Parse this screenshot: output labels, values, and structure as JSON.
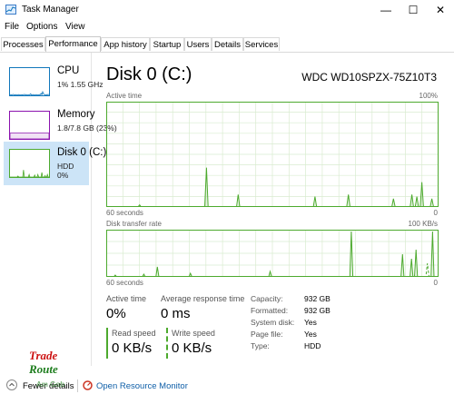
{
  "window": {
    "title": "Task Manager",
    "minimize": "—",
    "maximize": "☐",
    "close": "✕"
  },
  "menu": [
    "File",
    "Options",
    "View"
  ],
  "tabs": [
    "Processes",
    "Performance",
    "App history",
    "Startup",
    "Users",
    "Details",
    "Services"
  ],
  "active_tab": "Performance",
  "sidebar": [
    {
      "name": "CPU",
      "sub1": "1% 1.55 GHz",
      "sub2": ""
    },
    {
      "name": "Memory",
      "sub1": "1.8/7.8 GB (23%)",
      "sub2": ""
    },
    {
      "name": "Disk 0 (C:)",
      "sub1": "HDD",
      "sub2": "0%"
    }
  ],
  "disk": {
    "title": "Disk 0 (C:)",
    "model": "WDC WD10SPZX-75Z10T3",
    "active_time_label": "Active time",
    "active_time_max": "100%",
    "time_left": "60 seconds",
    "time_right": "0",
    "transfer_label": "Disk transfer rate",
    "transfer_max": "100 KB/s",
    "transfer_time_left": "60 seconds",
    "transfer_time_right": "0"
  },
  "stats": {
    "active_time_label": "Active time",
    "active_time_value": "0%",
    "avg_response_label": "Average response time",
    "avg_response_value": "0 ms",
    "read_label": "Read speed",
    "read_value": "0 KB/s",
    "write_label": "Write speed",
    "write_value": "0 KB/s"
  },
  "info": [
    {
      "label": "Capacity:",
      "value": "932 GB"
    },
    {
      "label": "Formatted:",
      "value": "932 GB"
    },
    {
      "label": "System disk:",
      "value": "Yes"
    },
    {
      "label": "Page file:",
      "value": "Yes"
    },
    {
      "label": "Type:",
      "value": "HDD"
    }
  ],
  "footer": {
    "fewer_details": "Fewer details",
    "open_monitor": "Open Resource Monitor",
    "watermark_line1": "Trade",
    "watermark_line2": "Route",
    "watermark_line3": "Am Gob"
  },
  "colors": {
    "disk_green": "#4daa2e",
    "grid_green": "#d9ecd0",
    "mem_purple": "#8b12ae",
    "cpu_blue": "#1177bb",
    "selected_bg": "#cce4f7",
    "link_blue": "#0f5fa8",
    "watermark_red": "#cc1111",
    "watermark_green": "#1d7d1d"
  },
  "charts": {
    "active_time": [
      0,
      0,
      0,
      0,
      0,
      0,
      0,
      0,
      0,
      0,
      0,
      0,
      0,
      0,
      0,
      0,
      0,
      0,
      0,
      0,
      2,
      0,
      0,
      0,
      0,
      0,
      0,
      0,
      0,
      0,
      0,
      0,
      0,
      0,
      0,
      0,
      0,
      0,
      0,
      0,
      0,
      0,
      0,
      0,
      0,
      0,
      0,
      0,
      0,
      0,
      0,
      0,
      0,
      0,
      0,
      0,
      0,
      0,
      0,
      0,
      38,
      0,
      0,
      0,
      0,
      0,
      0,
      0,
      0,
      0,
      0,
      0,
      0,
      0,
      0,
      0,
      0,
      0,
      0,
      12,
      0,
      0,
      0,
      0,
      0,
      0,
      0,
      0,
      0,
      0,
      0,
      0,
      0,
      0,
      0,
      0,
      0,
      0,
      0,
      0,
      0,
      0,
      0,
      0,
      0,
      0,
      0,
      0,
      0,
      0,
      0,
      0,
      0,
      0,
      0,
      0,
      0,
      0,
      0,
      0,
      0,
      0,
      0,
      0,
      0,
      10,
      0,
      0,
      0,
      0,
      0,
      0,
      0,
      0,
      0,
      0,
      0,
      0,
      0,
      0,
      0,
      0,
      0,
      0,
      0,
      12,
      0,
      0,
      0,
      0,
      0,
      0,
      0,
      0,
      0,
      0,
      0,
      0,
      0,
      0,
      0,
      0,
      0,
      0,
      0,
      0,
      0,
      0,
      0,
      0,
      0,
      0,
      8,
      0,
      0,
      0,
      0,
      0,
      0,
      0,
      0,
      0,
      0,
      12,
      0,
      0,
      10,
      0,
      0,
      24,
      0,
      0,
      0,
      0,
      0,
      8,
      0,
      0,
      0,
      0
    ],
    "transfer_read": [
      0,
      0,
      0,
      0,
      0,
      0,
      0,
      0,
      0,
      0,
      0,
      0,
      0,
      0,
      0,
      0,
      0,
      0,
      0,
      0,
      0,
      0,
      0,
      0,
      0,
      0,
      0,
      0,
      0,
      0,
      0,
      0,
      0,
      0,
      0,
      0,
      0,
      0,
      0,
      0,
      0,
      0,
      0,
      0,
      0,
      0,
      0,
      0,
      0,
      0,
      0,
      0,
      0,
      0,
      0,
      0,
      0,
      0,
      0,
      0,
      0,
      0,
      0,
      0,
      0,
      0,
      0,
      0,
      0,
      0,
      0,
      0,
      0,
      0,
      0,
      0,
      0,
      0,
      0,
      0,
      0,
      0,
      0,
      0,
      0,
      0,
      0,
      0,
      0,
      0,
      0,
      0,
      0,
      0,
      0,
      0,
      0,
      0,
      0,
      0,
      0,
      0,
      0,
      0,
      0,
      0,
      0,
      0,
      0,
      0,
      0,
      0,
      0,
      0,
      0,
      0,
      0,
      0,
      0,
      0,
      0,
      0,
      0,
      0,
      0,
      0,
      0,
      0,
      0,
      0,
      0,
      0,
      0,
      0,
      0,
      0,
      0,
      0,
      0,
      0,
      0,
      0,
      0,
      0,
      0,
      0,
      0,
      0,
      0,
      0,
      0,
      0,
      0,
      0,
      0,
      0,
      0,
      0,
      0,
      0,
      0,
      0,
      0,
      0,
      0,
      0,
      0,
      0,
      0,
      0,
      0,
      0,
      0,
      0,
      0,
      0,
      0,
      0,
      0,
      0,
      0,
      0,
      0,
      0,
      0,
      0,
      0,
      0,
      0,
      0,
      0,
      0,
      0,
      0,
      0,
      0,
      0,
      0,
      0,
      0,
      0,
      0,
      30,
      0,
      0,
      0,
      0,
      0,
      0,
      0
    ],
    "transfer_write": [
      0,
      0,
      0,
      0,
      0,
      0,
      4,
      0,
      0,
      0,
      0,
      0,
      0,
      0,
      0,
      0,
      0,
      0,
      0,
      0,
      0,
      0,
      0,
      0,
      0,
      6,
      0,
      0,
      0,
      0,
      0,
      0,
      0,
      0,
      22,
      0,
      0,
      0,
      0,
      0,
      0,
      0,
      0,
      0,
      0,
      0,
      0,
      0,
      0,
      0,
      0,
      0,
      0,
      0,
      0,
      0,
      8,
      0,
      0,
      0,
      0,
      0,
      0,
      0,
      0,
      0,
      0,
      0,
      0,
      0,
      0,
      0,
      0,
      0,
      0,
      0,
      0,
      0,
      0,
      0,
      0,
      0,
      0,
      0,
      0,
      0,
      0,
      0,
      0,
      0,
      0,
      0,
      0,
      0,
      0,
      0,
      0,
      0,
      0,
      0,
      0,
      0,
      0,
      0,
      0,
      0,
      0,
      0,
      0,
      12,
      0,
      0,
      0,
      0,
      0,
      0,
      0,
      0,
      0,
      0,
      0,
      0,
      0,
      0,
      0,
      0,
      0,
      0,
      0,
      0,
      0,
      0,
      0,
      0,
      0,
      0,
      0,
      0,
      0,
      0,
      0,
      0,
      0,
      0,
      0,
      0,
      0,
      0,
      0,
      0,
      0,
      0,
      0,
      0,
      0,
      0,
      0,
      0,
      0,
      0,
      0,
      0,
      0,
      100,
      0,
      0,
      0,
      0,
      0,
      0,
      0,
      0,
      0,
      0,
      0,
      0,
      0,
      0,
      0,
      0,
      0,
      0,
      0,
      0,
      0,
      0,
      0,
      0,
      0,
      0,
      0,
      0,
      0,
      0,
      0,
      0,
      0,
      50,
      0,
      0,
      0,
      0,
      0,
      40,
      0,
      0,
      60,
      0,
      0,
      0,
      0,
      0,
      0,
      0,
      0,
      0,
      0,
      100,
      0,
      0,
      0,
      0
    ]
  },
  "sidebar_charts": {
    "cpu": [
      2,
      3,
      1,
      2,
      4,
      2,
      1,
      3,
      2,
      1,
      2,
      3,
      2,
      1,
      2,
      3,
      1,
      2,
      4,
      2,
      3,
      2,
      1,
      2,
      3,
      2,
      6,
      1,
      2,
      3,
      2,
      1,
      2,
      3,
      2,
      1,
      2,
      3,
      2,
      8,
      2,
      14,
      6,
      3,
      2,
      1,
      3,
      2,
      4,
      2
    ],
    "memory": [
      23,
      23,
      23,
      23,
      23,
      23,
      23,
      23,
      23,
      23,
      23,
      23,
      23,
      23,
      23,
      23,
      23,
      23,
      23,
      23,
      23,
      23,
      23,
      23,
      23,
      23,
      23,
      23,
      23,
      23,
      23,
      23,
      23,
      23,
      23,
      23,
      23,
      23,
      23,
      23,
      23,
      23,
      23,
      23,
      23,
      23,
      23,
      23,
      23,
      23
    ],
    "disk": [
      0,
      0,
      0,
      0,
      0,
      0,
      0,
      0,
      0,
      0,
      4,
      0,
      0,
      0,
      0,
      0,
      0,
      28,
      0,
      0,
      0,
      0,
      0,
      0,
      10,
      0,
      0,
      0,
      0,
      0,
      0,
      8,
      0,
      0,
      0,
      10,
      0,
      0,
      0,
      0,
      18,
      0,
      0,
      0,
      6,
      0,
      0,
      10,
      0,
      0
    ]
  }
}
